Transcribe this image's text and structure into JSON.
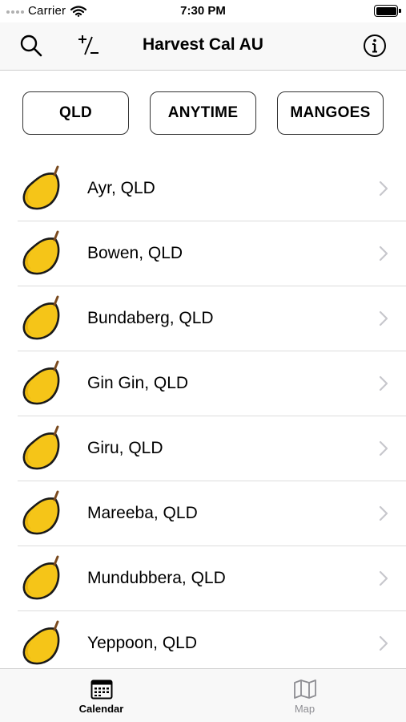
{
  "status_bar": {
    "carrier": "Carrier",
    "time": "7:30 PM"
  },
  "nav": {
    "title": "Harvest Cal AU",
    "search_icon": "search-icon",
    "plus_minus_icon": "plus-minus-icon",
    "info_icon": "info-icon"
  },
  "filters": {
    "region": "QLD",
    "season": "ANYTIME",
    "produce": "MANGOES"
  },
  "locations": [
    {
      "label": "Ayr, QLD",
      "icon": "mango-icon"
    },
    {
      "label": "Bowen, QLD",
      "icon": "mango-icon"
    },
    {
      "label": "Bundaberg, QLD",
      "icon": "mango-icon"
    },
    {
      "label": "Gin Gin, QLD",
      "icon": "mango-icon"
    },
    {
      "label": "Giru, QLD",
      "icon": "mango-icon"
    },
    {
      "label": "Mareeba, QLD",
      "icon": "mango-icon"
    },
    {
      "label": "Mundubbera, QLD",
      "icon": "mango-icon"
    },
    {
      "label": "Yeppoon, QLD",
      "icon": "mango-icon"
    }
  ],
  "tabs": [
    {
      "label": "Calendar",
      "icon": "calendar-icon",
      "selected": true
    },
    {
      "label": "Map",
      "icon": "map-icon",
      "selected": false
    }
  ],
  "colors": {
    "mango_fill": "#f5c518",
    "mango_outline": "#1a1a1a",
    "stem": "#7a4a1e",
    "chevron": "#c7c7cc",
    "tab_inactive": "#8e8e93"
  }
}
